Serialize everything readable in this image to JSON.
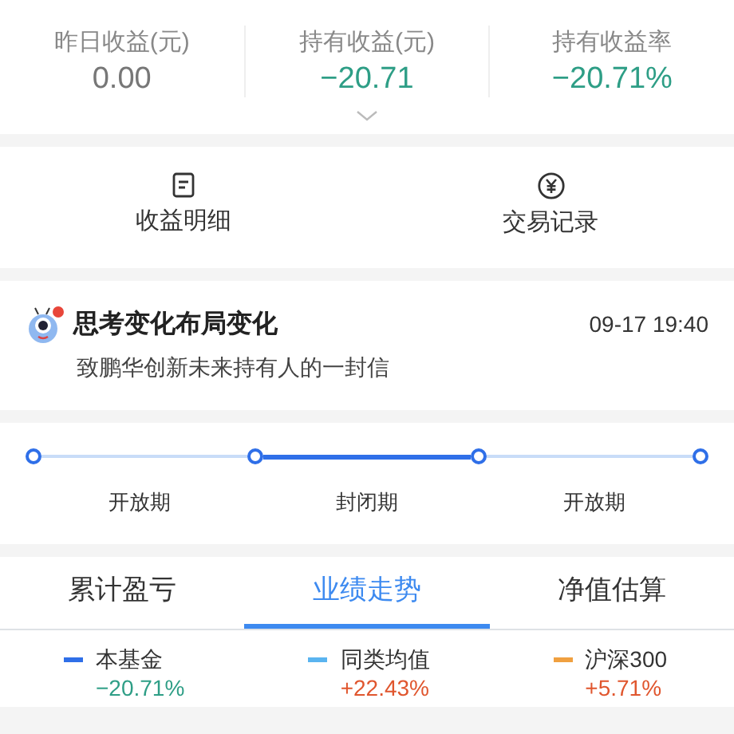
{
  "stats": [
    {
      "label": "昨日收益(元)",
      "value": "0.00",
      "color": "#777777"
    },
    {
      "label": "持有收益(元)",
      "value": "−20.71",
      "color": "#2e9e86"
    },
    {
      "label": "持有收益率",
      "value": "−20.71%",
      "color": "#2e9e86"
    }
  ],
  "actions": [
    {
      "kind": "document",
      "label": "收益明细"
    },
    {
      "kind": "yuan",
      "label": "交易记录"
    }
  ],
  "message": {
    "unread": true,
    "title": "思考变化布局变化",
    "time": "09-17 19:40",
    "subtitle": "致鹏华创新未来持有人的一封信"
  },
  "timeline": [
    {
      "label": "开放期",
      "active": false
    },
    {
      "label": "封闭期",
      "active": true
    },
    {
      "label": "开放期",
      "active": false
    }
  ],
  "tabs": [
    {
      "label": "累计盈亏",
      "selected": false
    },
    {
      "label": "业绩走势",
      "selected": true
    },
    {
      "label": "净值估算",
      "selected": false
    }
  ],
  "legend": [
    {
      "name": "本基金",
      "color": "#2f6fe8",
      "value": {
        "text": "−20.71%",
        "color": "#2e9e86"
      }
    },
    {
      "name": "同类均值",
      "color": "#5ab4f0",
      "value": {
        "text": "+22.43%",
        "color": "#e0562e"
      }
    },
    {
      "name": "沪深300",
      "color": "#f0a040",
      "value": {
        "text": "+5.71%",
        "color": "#e0562e"
      }
    }
  ]
}
